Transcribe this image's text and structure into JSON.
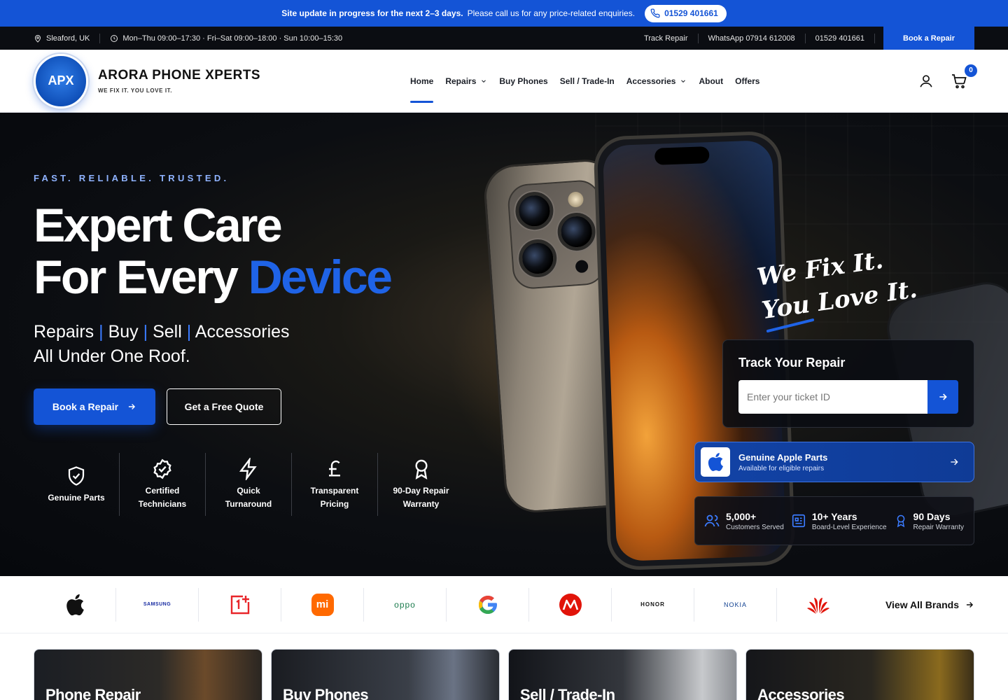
{
  "announcement": {
    "bold": "Site update in progress for the next 2–3 days.",
    "text": "Please call us for any price-related enquiries.",
    "phone": "01529 401661"
  },
  "utility": {
    "location": "Sleaford, UK",
    "hours": "Mon–Thu 09:00–17:30 · Fri–Sat 09:00–18:00 · Sun 10:00–15:30",
    "track": "Track Repair",
    "whatsapp": "WhatsApp 07914 612008",
    "phone": "01529 401661",
    "book": "Book a Repair"
  },
  "header": {
    "logo_text": "APX",
    "brand_name": "ARORA PHONE XPERTS",
    "tagline": "WE FIX IT. YOU LOVE IT.",
    "nav": [
      "Home",
      "Repairs",
      "Buy Phones",
      "Sell / Trade-In",
      "Accessories",
      "About",
      "Offers"
    ],
    "cart_count": "0"
  },
  "hero": {
    "kicker": "FAST. RELIABLE. TRUSTED.",
    "title_line1": "Expert Care",
    "title_line2_a": "For Every ",
    "title_line2_b": "Device",
    "sub_items": [
      "Repairs",
      "Buy",
      "Sell",
      "Accessories"
    ],
    "sub_line2": "All Under One Roof.",
    "primary_cta": "Book a Repair",
    "secondary_cta": "Get a Free Quote",
    "features": [
      {
        "icon": "shield-check-icon",
        "line1": "Genuine Parts",
        "line2": ""
      },
      {
        "icon": "badge-check-icon",
        "line1": "Certified",
        "line2": "Technicians"
      },
      {
        "icon": "lightning-icon",
        "line1": "Quick",
        "line2": "Turnaround"
      },
      {
        "icon": "pound-icon",
        "line1": "Transparent",
        "line2": "Pricing"
      },
      {
        "icon": "award-icon",
        "line1": "90-Day Repair",
        "line2": "Warranty"
      }
    ],
    "script_line1": "We Fix It.",
    "script_line2": "You Love It."
  },
  "track": {
    "title": "Track Your Repair",
    "placeholder": "Enter your ticket ID"
  },
  "genuine": {
    "title": "Genuine Apple Parts",
    "subtitle": "Available for eligible repairs"
  },
  "stats": [
    {
      "icon": "users-icon",
      "value": "5,000+",
      "label": "Customers Served"
    },
    {
      "icon": "chip-icon",
      "value": "10+ Years",
      "label": "Board-Level Experience"
    },
    {
      "icon": "ribbon-icon",
      "value": "90 Days",
      "label": "Repair Warranty"
    }
  ],
  "brands": {
    "items": [
      "apple",
      "SAMSUNG",
      "oneplus",
      "mi",
      "oppo",
      "google",
      "motorola",
      "HONOR",
      "NOKIA",
      "huawei"
    ],
    "samsung": "SAMSUNG",
    "oppo": "oppo",
    "honor": "HONOR",
    "nokia": "NOKIA",
    "mi": "mi",
    "view_all": "View All Brands"
  },
  "categories": [
    "Phone Repair",
    "Buy Phones",
    "Sell / Trade-In",
    "Accessories"
  ],
  "colors": {
    "primary": "#1454d6",
    "dark": "#0b0d12",
    "highlight": "#1f63e6"
  }
}
